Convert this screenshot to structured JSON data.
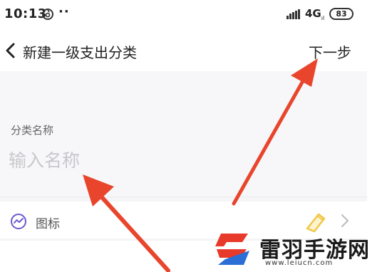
{
  "status_bar": {
    "time": "10:13",
    "dots": "··",
    "network": "4G",
    "network_sub": "ıl",
    "battery": "83"
  },
  "nav": {
    "title": "新建一级支出分类",
    "next_label": "下一步"
  },
  "form": {
    "name_label": "分类名称",
    "name_placeholder": "输入名称",
    "name_value": ""
  },
  "icon_row": {
    "label": "图标"
  },
  "watermark": {
    "title": "雷羽手游网",
    "url": "www.leiucn.com"
  },
  "colors": {
    "arrow": "#e8452c",
    "icon_accent": "#6a5acd",
    "pencil": "#f2c744",
    "watermark_red": "#e83a2a",
    "watermark_blue": "#2b6fd6"
  }
}
